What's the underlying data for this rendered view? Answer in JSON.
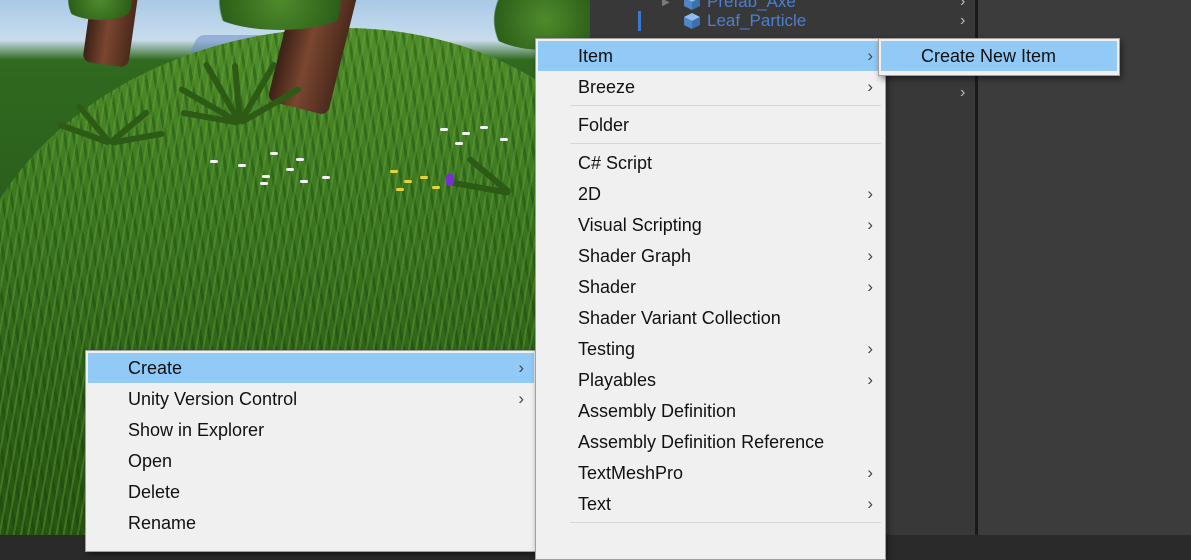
{
  "hierarchy": {
    "rows": [
      {
        "label": "Prefab_Axe",
        "icon": "prefab-cube-icon"
      },
      {
        "label": "Leaf_Particle",
        "icon": "prefab-cube-icon"
      }
    ]
  },
  "context_menu": {
    "items": [
      {
        "label": "Create",
        "has_submenu": true,
        "highlighted": true
      },
      {
        "label": "Unity Version Control",
        "has_submenu": true
      },
      {
        "label": "Show in Explorer"
      },
      {
        "label": "Open"
      },
      {
        "label": "Delete"
      },
      {
        "label": "Rename"
      }
    ]
  },
  "create_submenu": {
    "items": [
      {
        "label": "Item",
        "has_submenu": true,
        "highlighted": true
      },
      {
        "label": "Breeze",
        "has_submenu": true
      },
      {
        "label": "Folder"
      },
      {
        "label": "C# Script"
      },
      {
        "label": "2D",
        "has_submenu": true
      },
      {
        "label": "Visual Scripting",
        "has_submenu": true
      },
      {
        "label": "Shader Graph",
        "has_submenu": true
      },
      {
        "label": "Shader",
        "has_submenu": true
      },
      {
        "label": "Shader Variant Collection"
      },
      {
        "label": "Testing",
        "has_submenu": true
      },
      {
        "label": "Playables",
        "has_submenu": true
      },
      {
        "label": "Assembly Definition"
      },
      {
        "label": "Assembly Definition Reference"
      },
      {
        "label": "TextMeshPro",
        "has_submenu": true
      },
      {
        "label": "Text",
        "has_submenu": true
      }
    ]
  },
  "item_submenu": {
    "items": [
      {
        "label": "Create New Item",
        "highlighted": true
      }
    ]
  },
  "glyphs": {
    "submenu_arrow": "›",
    "expand_triangle": "▶"
  },
  "colors": {
    "menu_background": "#f0f0f0",
    "menu_highlight": "#91c9f7",
    "panel_dark": "#383838",
    "hierarchy_text": "#4a7fd1"
  }
}
